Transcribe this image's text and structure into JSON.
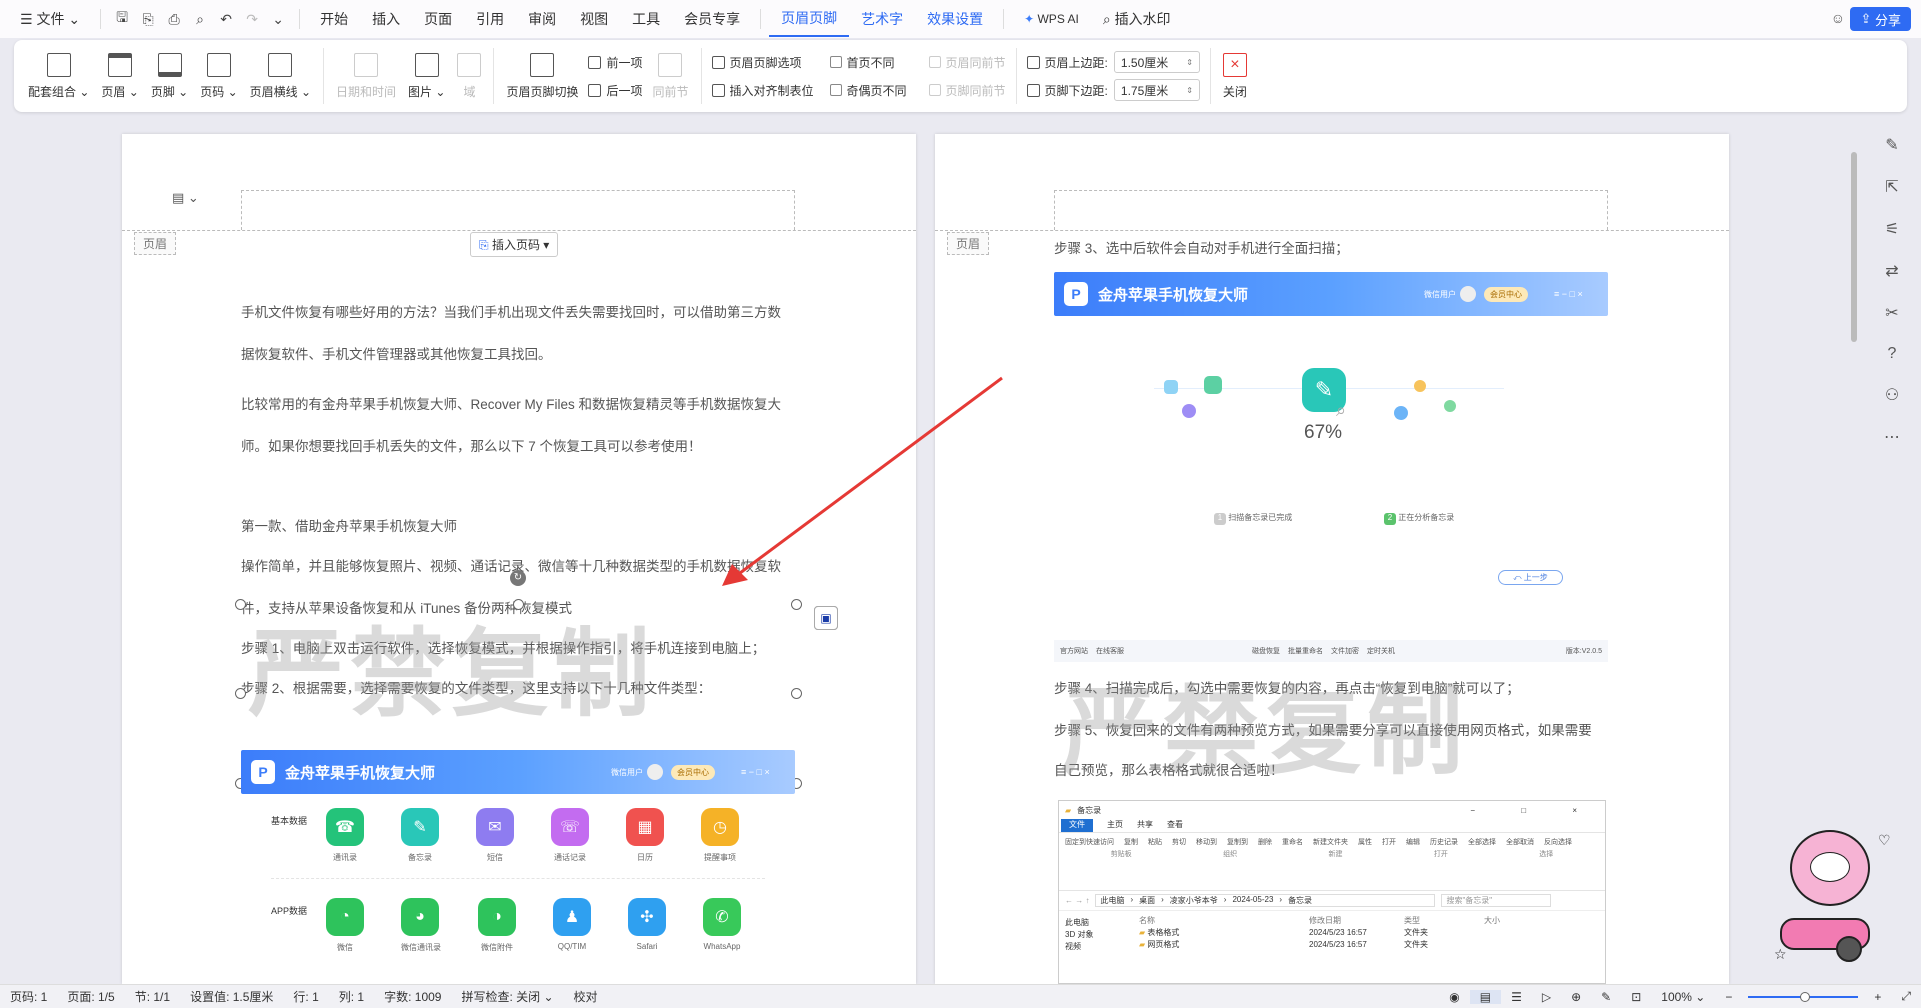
{
  "menubar": {
    "file": "文件",
    "tabs": [
      "开始",
      "插入",
      "页面",
      "引用",
      "审阅",
      "视图",
      "工具",
      "会员专享"
    ],
    "active_tab": "页眉页脚",
    "extra_tabs": [
      "艺术字",
      "效果设置"
    ],
    "wps_ai": "WPS AI",
    "insert_watermark": "插入水印",
    "share": "分享"
  },
  "toolbar": {
    "combo": "配套组合",
    "header": "页眉",
    "footer": "页脚",
    "page_num": "页码",
    "header_line": "页眉横线",
    "datetime": "日期和时间",
    "picture": "图片",
    "field": "域",
    "switch": "页眉页脚切换",
    "prev": "前一项",
    "next": "后一项",
    "same_prev": "同前节",
    "hf_options": "页眉页脚选项",
    "insert_align_tab": "插入对齐制表位",
    "first_diff": "首页不同",
    "odd_even_diff": "奇偶页不同",
    "hdr_same_prev": "页眉同前节",
    "ftr_same_prev": "页脚同前节",
    "top_margin_label": "页眉上边距:",
    "top_margin": "1.50厘米",
    "bottom_margin_label": "页脚下边距:",
    "bottom_margin": "1.75厘米",
    "close": "关闭"
  },
  "page1": {
    "header_tag": "页眉",
    "insert_page_num": "插入页码",
    "p1": "手机文件恢复有哪些好用的方法？当我们手机出现文件丢失需要找回时，可以借助第三方数",
    "p2": "据恢复软件、手机文件管理器或其他恢复工具找回。",
    "p3": "比较常用的有金舟苹果手机恢复大师、Recover My Files 和数据恢复精灵等手机数据恢复大",
    "p4": "师。如果你想要找回手机丢失的文件，那么以下 7 个恢复工具可以参考使用！",
    "p5": "第一款、借助金舟苹果手机恢复大师",
    "p6": "操作简单，并且能够恢复照片、视频、通话记录、微信等十几种数据类型的手机数据恢复软",
    "p7": "件，支持从苹果设备恢复和从 iTunes 备份两种恢复模式",
    "p8": "步骤 1、电脑上双击运行软件，选择恢复模式，并根据操作指引，将手机连接到电脑上；",
    "p9": "步骤 2、根据需要，选择需要恢复的文件类型，这里支持以下十几种文件类型：",
    "watermark": "严禁复制",
    "app_title": "金舟苹果手机恢复大师",
    "app_user": "微信用户",
    "app_vip": "会员中心",
    "basic_label": "基本数据",
    "app_label": "APP数据",
    "basic_icons": [
      "通讯录",
      "备忘录",
      "短信",
      "通话记录",
      "日历",
      "提醒事项"
    ],
    "app_icons": [
      "微信",
      "微信通讯录",
      "微信附件",
      "QQ/TIM",
      "Safari",
      "WhatsApp"
    ]
  },
  "page2": {
    "header_tag": "页眉",
    "p1": "步骤 3、选中后软件会自动对手机进行全面扫描；",
    "app_title": "金舟苹果手机恢复大师",
    "app_user": "微信用户",
    "app_vip": "会员中心",
    "percent": "67%",
    "step1": "扫描备忘录已完成",
    "step2": "正在分析备忘录",
    "back": "上一步",
    "footer_items": [
      "官方网站",
      "在线客服",
      "磁盘恢复",
      "批量重命名",
      "文件加密",
      "定时关机"
    ],
    "version": "版本:V2.0.5",
    "p2": "步骤 4、扫描完成后，勾选中需要恢复的内容，再点击“恢复到电脑”就可以了；",
    "p3": "步骤 5、恢复回来的文件有两种预览方式，如果需要分享可以直接使用网页格式，如果需要",
    "p4": "自己预览，那么表格格式就很合适啦！",
    "watermark": "严禁复制",
    "explorer": {
      "title": "备忘录",
      "tabs": [
        "文件",
        "主页",
        "共享",
        "查看"
      ],
      "path": [
        "此电脑",
        "桌面",
        "凌家小爷本爷",
        "2024-05-23",
        "备忘录"
      ],
      "search": "搜索\"备忘录\"",
      "nav": [
        "此电脑",
        "3D 对象",
        "视频"
      ],
      "cols": [
        "名称",
        "修改日期",
        "类型",
        "大小"
      ],
      "files": [
        {
          "name": "表格格式",
          "date": "2024/5/23 16:57",
          "type": "文件夹"
        },
        {
          "name": "网页格式",
          "date": "2024/5/23 16:57",
          "type": "文件夹"
        }
      ],
      "ribbon": [
        "固定到快速访问",
        "复制",
        "粘贴",
        "剪切",
        "移动到",
        "复制到",
        "删除",
        "重命名",
        "新建文件夹",
        "属性",
        "打开",
        "编辑",
        "历史记录",
        "全部选择",
        "全部取消",
        "反向选择"
      ],
      "groups": [
        "剪贴板",
        "组织",
        "新建",
        "打开",
        "选择"
      ]
    }
  },
  "status": {
    "page_num": "页码: 1",
    "pages": "页面: 1/5",
    "section": "节: 1/1",
    "setting": "设置值: 1.5厘米",
    "line": "行: 1",
    "column": "列: 1",
    "words": "字数: 1009",
    "spell": "拼写检查: 关闭",
    "proof": "校对",
    "zoom": "100%"
  },
  "colors": {
    "accent": "#2e6bf3",
    "arrow": "#e53935",
    "app_blue": "#3c7dfa"
  }
}
